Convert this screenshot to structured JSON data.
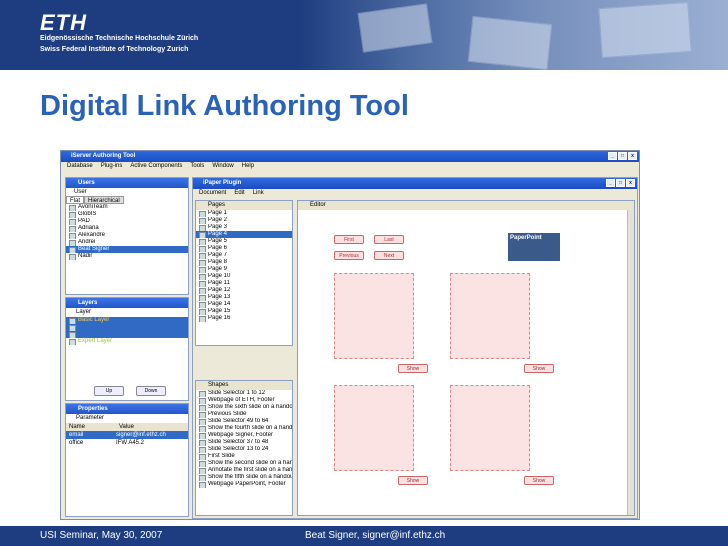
{
  "header": {
    "logo": "ETH",
    "line1": "Eidgenössische Technische Hochschule Zürich",
    "line2": "Swiss Federal Institute of Technology Zurich"
  },
  "slide_title": "Digital Link Authoring Tool",
  "footer": {
    "left": "USI Seminar, May 30, 2007",
    "right": "Beat Signer, signer@inf.ethz.ch"
  },
  "app": {
    "title": "iServer Authoring Tool",
    "menu": [
      "Database",
      "Plug-ins",
      "Active Components",
      "Tools",
      "Window",
      "Help"
    ],
    "users": {
      "title": "Users",
      "user_label": "User",
      "tabs": [
        "Flat",
        "Hierarchical"
      ],
      "items": [
        "AvoniTeam",
        "GlobIS",
        "PAD",
        "Adriana",
        "Alexandre",
        "Andrei",
        "Beat Signer",
        "Nadir"
      ]
    },
    "layers": {
      "title": "Layers",
      "layer_label": "Layer",
      "items": [
        "Basic Layer",
        "",
        "",
        "Expert Layer"
      ],
      "up": "Up",
      "down": "Down"
    },
    "properties": {
      "title": "Properties",
      "param_label": "Parameter",
      "cols": [
        "Name",
        "Value"
      ],
      "rows": [
        [
          "email",
          "signer@inf.ethz.ch"
        ],
        [
          "office",
          "IFW A45.2"
        ]
      ]
    },
    "plugin": {
      "title": "iPaper Plugin",
      "menu": [
        "Document",
        "Edit",
        "Link"
      ]
    },
    "pages": {
      "title": "Pages",
      "items": [
        "Page 1",
        "Page 2",
        "Page 3",
        "Page 4",
        "Page 5",
        "Page 6",
        "Page 7",
        "Page 8",
        "Page 9",
        "Page 10",
        "Page 11",
        "Page 12",
        "Page 13",
        "Page 14",
        "Page 15",
        "Page 16"
      ]
    },
    "shapes": {
      "title": "Shapes",
      "items": [
        "Slide Selector 1 to 12",
        "Webpage of ETH, Footer",
        "Show the sixth slide on a handout",
        "Previous Slide",
        "Slide Selector 49 to 64",
        "Show the fourth slide on a handout",
        "Webpage Signer, Footer",
        "Slide Selector 37 to 48",
        "Slide Selector 13 to 24",
        "First Slide",
        "Show the second slide on a handout",
        "Annotate the first slide on a handout",
        "Show the fifth slide on a handout",
        "Webpage PaperPoint, Footer"
      ]
    },
    "editor": {
      "title": "Editor",
      "buttons": [
        "First",
        "Last",
        "Previous",
        "Next"
      ],
      "show": "Show",
      "paperpoint": "PaperPoint"
    }
  }
}
